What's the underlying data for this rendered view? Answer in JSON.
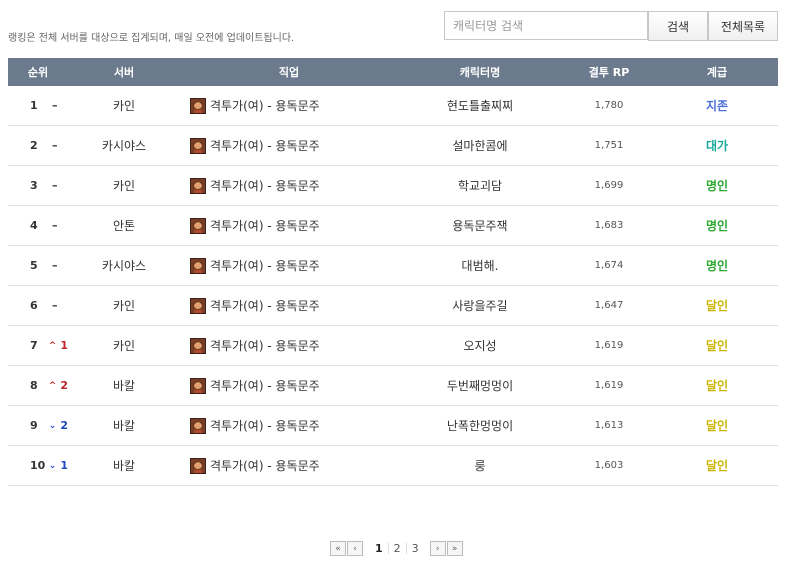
{
  "notice": "랭킹은 전체 서버를 대상으로 집계되며, 매일 오전에 업데이트됩니다.",
  "search": {
    "placeholder": "캐릭터명 검색",
    "search_label": "검색",
    "all_label": "전체목록"
  },
  "table": {
    "headers": {
      "rank": "순위",
      "server": "서버",
      "job": "직업",
      "character": "캐릭터명",
      "rp": "결투 RP",
      "grade": "계급"
    },
    "rows": [
      {
        "rank": "1",
        "change_dir": "same",
        "change": "–",
        "server": "카인",
        "job": "격투가(여) - 용독문주",
        "character": "현도틀출찌찌",
        "rp": "1,780",
        "grade": "지존",
        "grade_color": "#4a6fd8"
      },
      {
        "rank": "2",
        "change_dir": "same",
        "change": "–",
        "server": "카시야스",
        "job": "격투가(여) - 용독문주",
        "character": "설마한콤에",
        "rp": "1,751",
        "grade": "대가",
        "grade_color": "#16a89a"
      },
      {
        "rank": "3",
        "change_dir": "same",
        "change": "–",
        "server": "카인",
        "job": "격투가(여) - 용독문주",
        "character": "학교괴담",
        "rp": "1,699",
        "grade": "명인",
        "grade_color": "#2fa82f"
      },
      {
        "rank": "4",
        "change_dir": "same",
        "change": "–",
        "server": "안톤",
        "job": "격투가(여) - 용독문주",
        "character": "용독문주잭",
        "rp": "1,683",
        "grade": "명인",
        "grade_color": "#2fa82f"
      },
      {
        "rank": "5",
        "change_dir": "same",
        "change": "–",
        "server": "카시야스",
        "job": "격투가(여) - 용독문주",
        "character": "대범해.",
        "rp": "1,674",
        "grade": "명인",
        "grade_color": "#2fa82f"
      },
      {
        "rank": "6",
        "change_dir": "same",
        "change": "–",
        "server": "카인",
        "job": "격투가(여) - 용독문주",
        "character": "사랑을주길",
        "rp": "1,647",
        "grade": "달인",
        "grade_color": "#c9b400"
      },
      {
        "rank": "7",
        "change_dir": "up",
        "change": "1",
        "server": "카인",
        "job": "격투가(여) - 용독문주",
        "character": "오지성",
        "rp": "1,619",
        "grade": "달인",
        "grade_color": "#c9b400"
      },
      {
        "rank": "8",
        "change_dir": "up",
        "change": "2",
        "server": "바칼",
        "job": "격투가(여) - 용독문주",
        "character": "두번째멍멍이",
        "rp": "1,619",
        "grade": "달인",
        "grade_color": "#c9b400"
      },
      {
        "rank": "9",
        "change_dir": "down",
        "change": "2",
        "server": "바칼",
        "job": "격투가(여) - 용독문주",
        "character": "난폭한멍멍이",
        "rp": "1,613",
        "grade": "달인",
        "grade_color": "#c9b400"
      },
      {
        "rank": "10",
        "change_dir": "down",
        "change": "1",
        "server": "바칼",
        "job": "격투가(여) - 용독문주",
        "character": "룽",
        "rp": "1,603",
        "grade": "달인",
        "grade_color": "#c9b400"
      }
    ]
  },
  "pagination": {
    "first_icon": "double-chevron-left-icon",
    "prev_icon": "chevron-left-icon",
    "next_icon": "chevron-right-icon",
    "last_icon": "double-chevron-right-icon",
    "pages": [
      "1",
      "2",
      "3"
    ],
    "current": "1"
  },
  "icons": {
    "job_icon": "fighter-portrait-icon",
    "up": "caret-up-icon",
    "down": "caret-down-icon"
  }
}
